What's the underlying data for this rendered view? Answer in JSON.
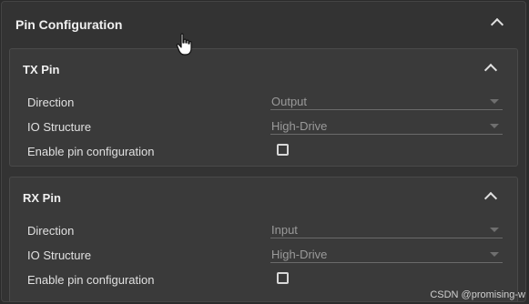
{
  "panel": {
    "title": "Pin Configuration"
  },
  "sections": [
    {
      "title": "TX Pin",
      "direction": {
        "label": "Direction",
        "value": "Output"
      },
      "io_structure": {
        "label": "IO Structure",
        "value": "High-Drive"
      },
      "enable": {
        "label": "Enable pin configuration",
        "checked": false
      }
    },
    {
      "title": "RX Pin",
      "direction": {
        "label": "Direction",
        "value": "Input"
      },
      "io_structure": {
        "label": "IO Structure",
        "value": "High-Drive"
      },
      "enable": {
        "label": "Enable pin configuration",
        "checked": false
      }
    }
  ],
  "watermark": "CSDN @promising-w",
  "colors": {
    "background": "#2b2b2b",
    "panel": "#333333",
    "section": "#3a3a3a",
    "text": "#e0e0e0",
    "muted_value": "#9a9a9a"
  }
}
